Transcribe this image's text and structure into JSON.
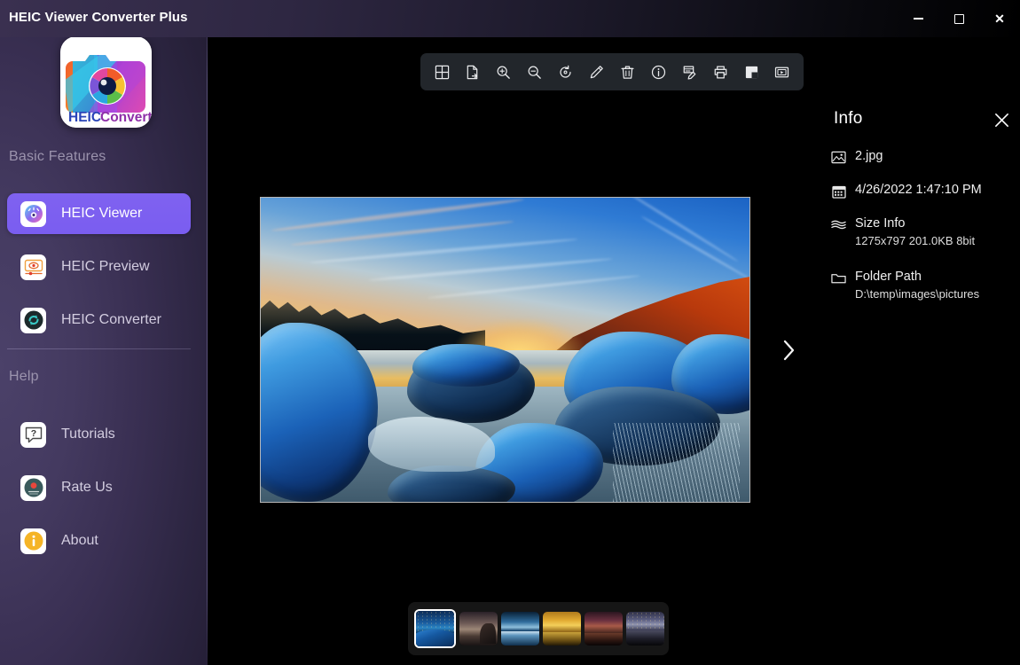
{
  "window": {
    "title": "HEIC Viewer Converter Plus",
    "controls": [
      {
        "name": "minimize",
        "label": "—"
      },
      {
        "name": "maximize",
        "label": "□"
      },
      {
        "name": "close",
        "label": "✕"
      }
    ]
  },
  "sidebar": {
    "logo_alt": "HEIC Converter",
    "logo_text_left": "HEIC",
    "logo_text_right": "Converter",
    "sections": [
      {
        "label": "Basic Features"
      },
      {
        "label": "Help"
      }
    ],
    "items": [
      {
        "label": "HEIC Viewer",
        "icon": "heic-viewer-icon",
        "active": true
      },
      {
        "label": "HEIC Preview",
        "icon": "heic-preview-icon",
        "active": false
      },
      {
        "label": "HEIC Converter",
        "icon": "heic-converter-icon",
        "active": false
      },
      {
        "label": "Tutorials",
        "icon": "question-bubble-icon",
        "active": false
      },
      {
        "label": "Rate Us",
        "icon": "rate-us-icon",
        "active": false
      },
      {
        "label": "About",
        "icon": "info-circle-icon",
        "active": false
      }
    ]
  },
  "toolbar": {
    "buttons": [
      {
        "name": "grid-view-button",
        "icon": "grid-icon",
        "tooltip": "Grid View"
      },
      {
        "name": "open-file-button",
        "icon": "file-export-icon",
        "tooltip": "Open File"
      },
      {
        "name": "zoom-in-button",
        "icon": "zoom-in-icon",
        "tooltip": "Zoom In"
      },
      {
        "name": "zoom-out-button",
        "icon": "zoom-out-icon",
        "tooltip": "Zoom Out"
      },
      {
        "name": "rotate-button",
        "icon": "rotate-icon",
        "tooltip": "Rotate"
      },
      {
        "name": "edit-button",
        "icon": "pencil-icon",
        "tooltip": "Edit"
      },
      {
        "name": "delete-button",
        "icon": "trash-icon",
        "tooltip": "Delete"
      },
      {
        "name": "info-button",
        "icon": "info-circle-icon",
        "tooltip": "Info"
      },
      {
        "name": "rename-button",
        "icon": "file-edit-icon",
        "tooltip": "Rename"
      },
      {
        "name": "print-button",
        "icon": "printer-icon",
        "tooltip": "Print"
      },
      {
        "name": "background-button",
        "icon": "contrast-square-icon",
        "tooltip": "Background"
      },
      {
        "name": "slideshow-button",
        "icon": "slideshow-icon",
        "tooltip": "Slideshow"
      }
    ]
  },
  "viewer": {
    "next_arrow": "›",
    "image_alt": "Frozen lake at sunset with blue ice covered rocks"
  },
  "info": {
    "title": "Info",
    "close_label": "✕",
    "file_name": "2.jpg",
    "file_name_icon": "image-icon",
    "date": "4/26/2022 1:47:10 PM",
    "date_icon": "calendar-icon",
    "size_label": "Size Info",
    "size_icon": "layers-icon",
    "size_value": "1275x797 201.0KB  8bit",
    "folder_label": "Folder Path",
    "folder_icon": "folder-icon",
    "folder_value": "D:\\temp\\images\\pictures"
  },
  "thumbnails": {
    "selected_index": 0,
    "items": [
      {
        "name": "thumb-1",
        "variant": "t1",
        "selected": true
      },
      {
        "name": "thumb-2",
        "variant": "t2",
        "selected": false
      },
      {
        "name": "thumb-3",
        "variant": "t3",
        "selected": false
      },
      {
        "name": "thumb-4",
        "variant": "t4",
        "selected": false
      },
      {
        "name": "thumb-5",
        "variant": "t5",
        "selected": false
      },
      {
        "name": "thumb-6",
        "variant": "t6",
        "selected": false
      }
    ]
  },
  "colors": {
    "accent": "#7f62f0",
    "sidebar_top": "#4b4169",
    "sidebar_bottom": "#1b1727",
    "toolbar_bg": "#22262b",
    "stage_bg": "#000000",
    "text_primary": "#ffffff",
    "text_muted": "#9b93ad"
  }
}
